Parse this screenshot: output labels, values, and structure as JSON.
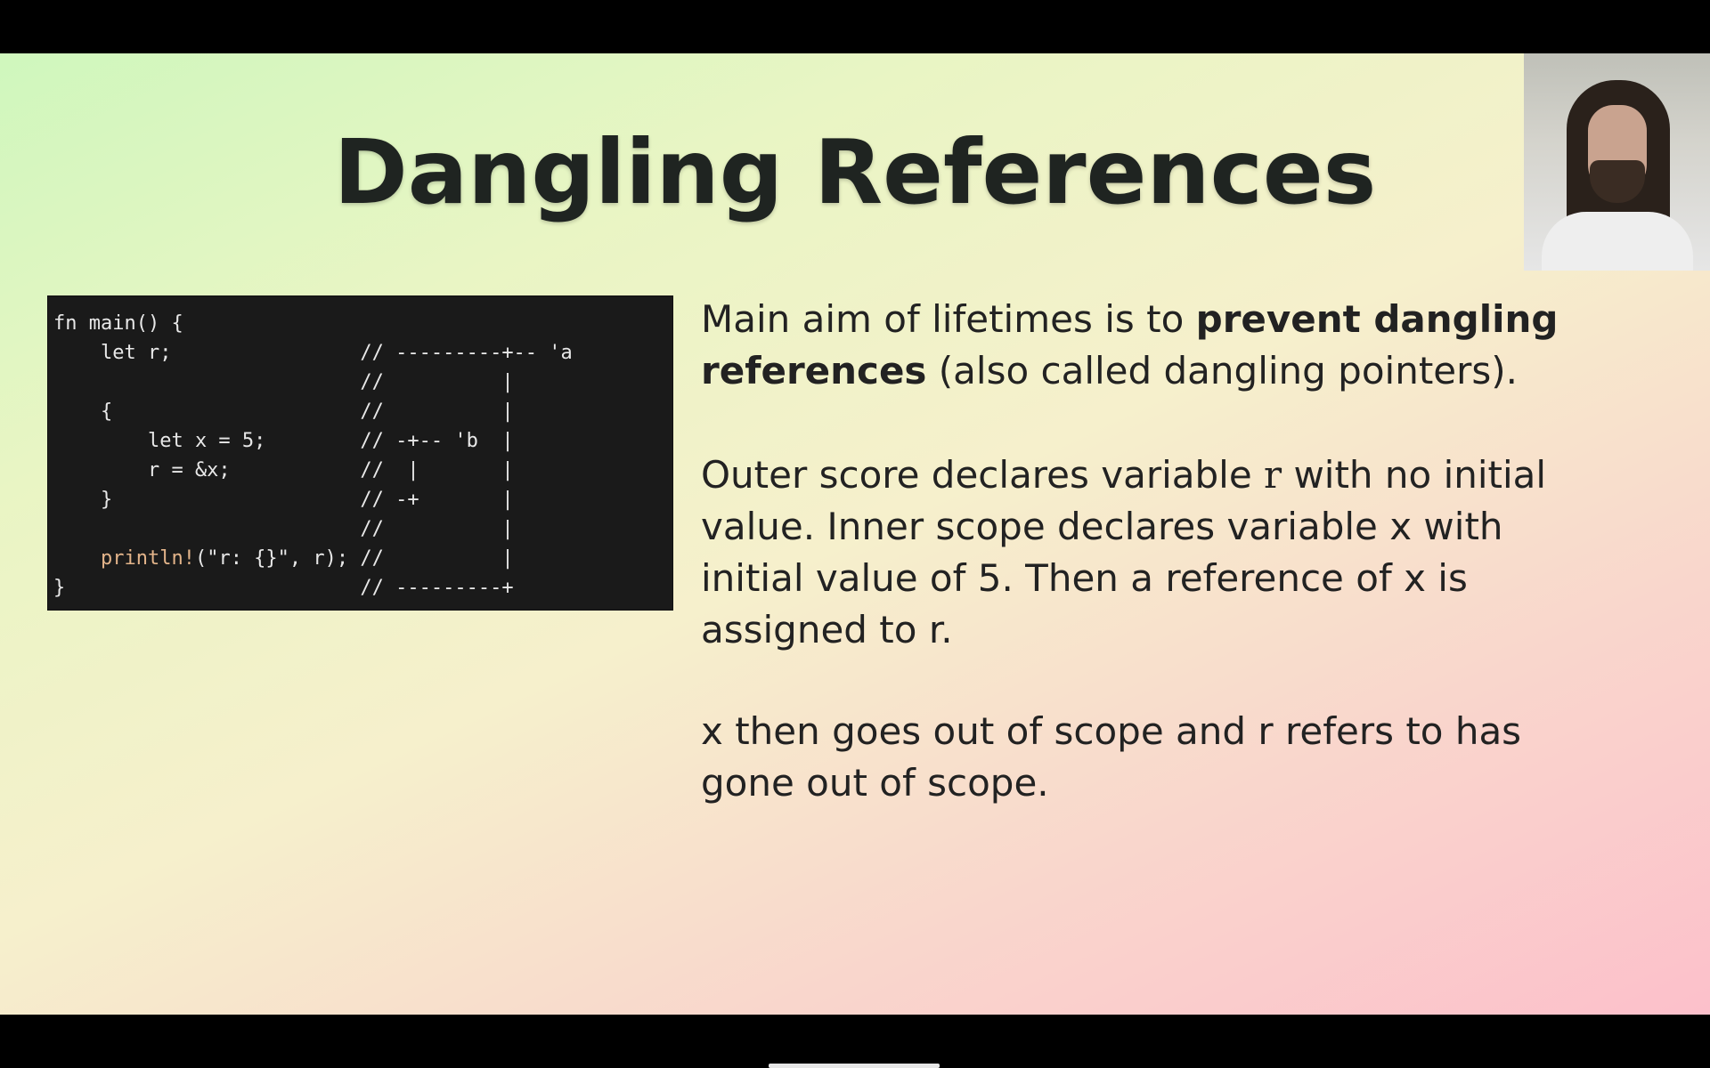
{
  "slide": {
    "title": "Dangling References",
    "code_lines": [
      "fn main() {",
      "    let r;                // ---------+-- 'a",
      "                          //          |",
      "    {                     //          |",
      "        let x = 5;        // -+-- 'b  |",
      "        r = &x;           //  |       |",
      "    }                     // -+       |",
      "                          //          |",
      "    println!(\"r: {}\", r); //          |",
      "}                         // ---------+"
    ],
    "p1_a": "Main aim of lifetimes is to ",
    "p1_bold": "prevent dangling references",
    "p1_b": " (also called dangling pointers).",
    "p2_a": "Outer score declares variable ",
    "p2_code": "r",
    "p2_b": " with no initial value. Inner scope declares variable x with initial value of 5. Then a reference of x is assigned to r.",
    "p3": "x then goes out of scope and r refers to has gone out of scope."
  }
}
